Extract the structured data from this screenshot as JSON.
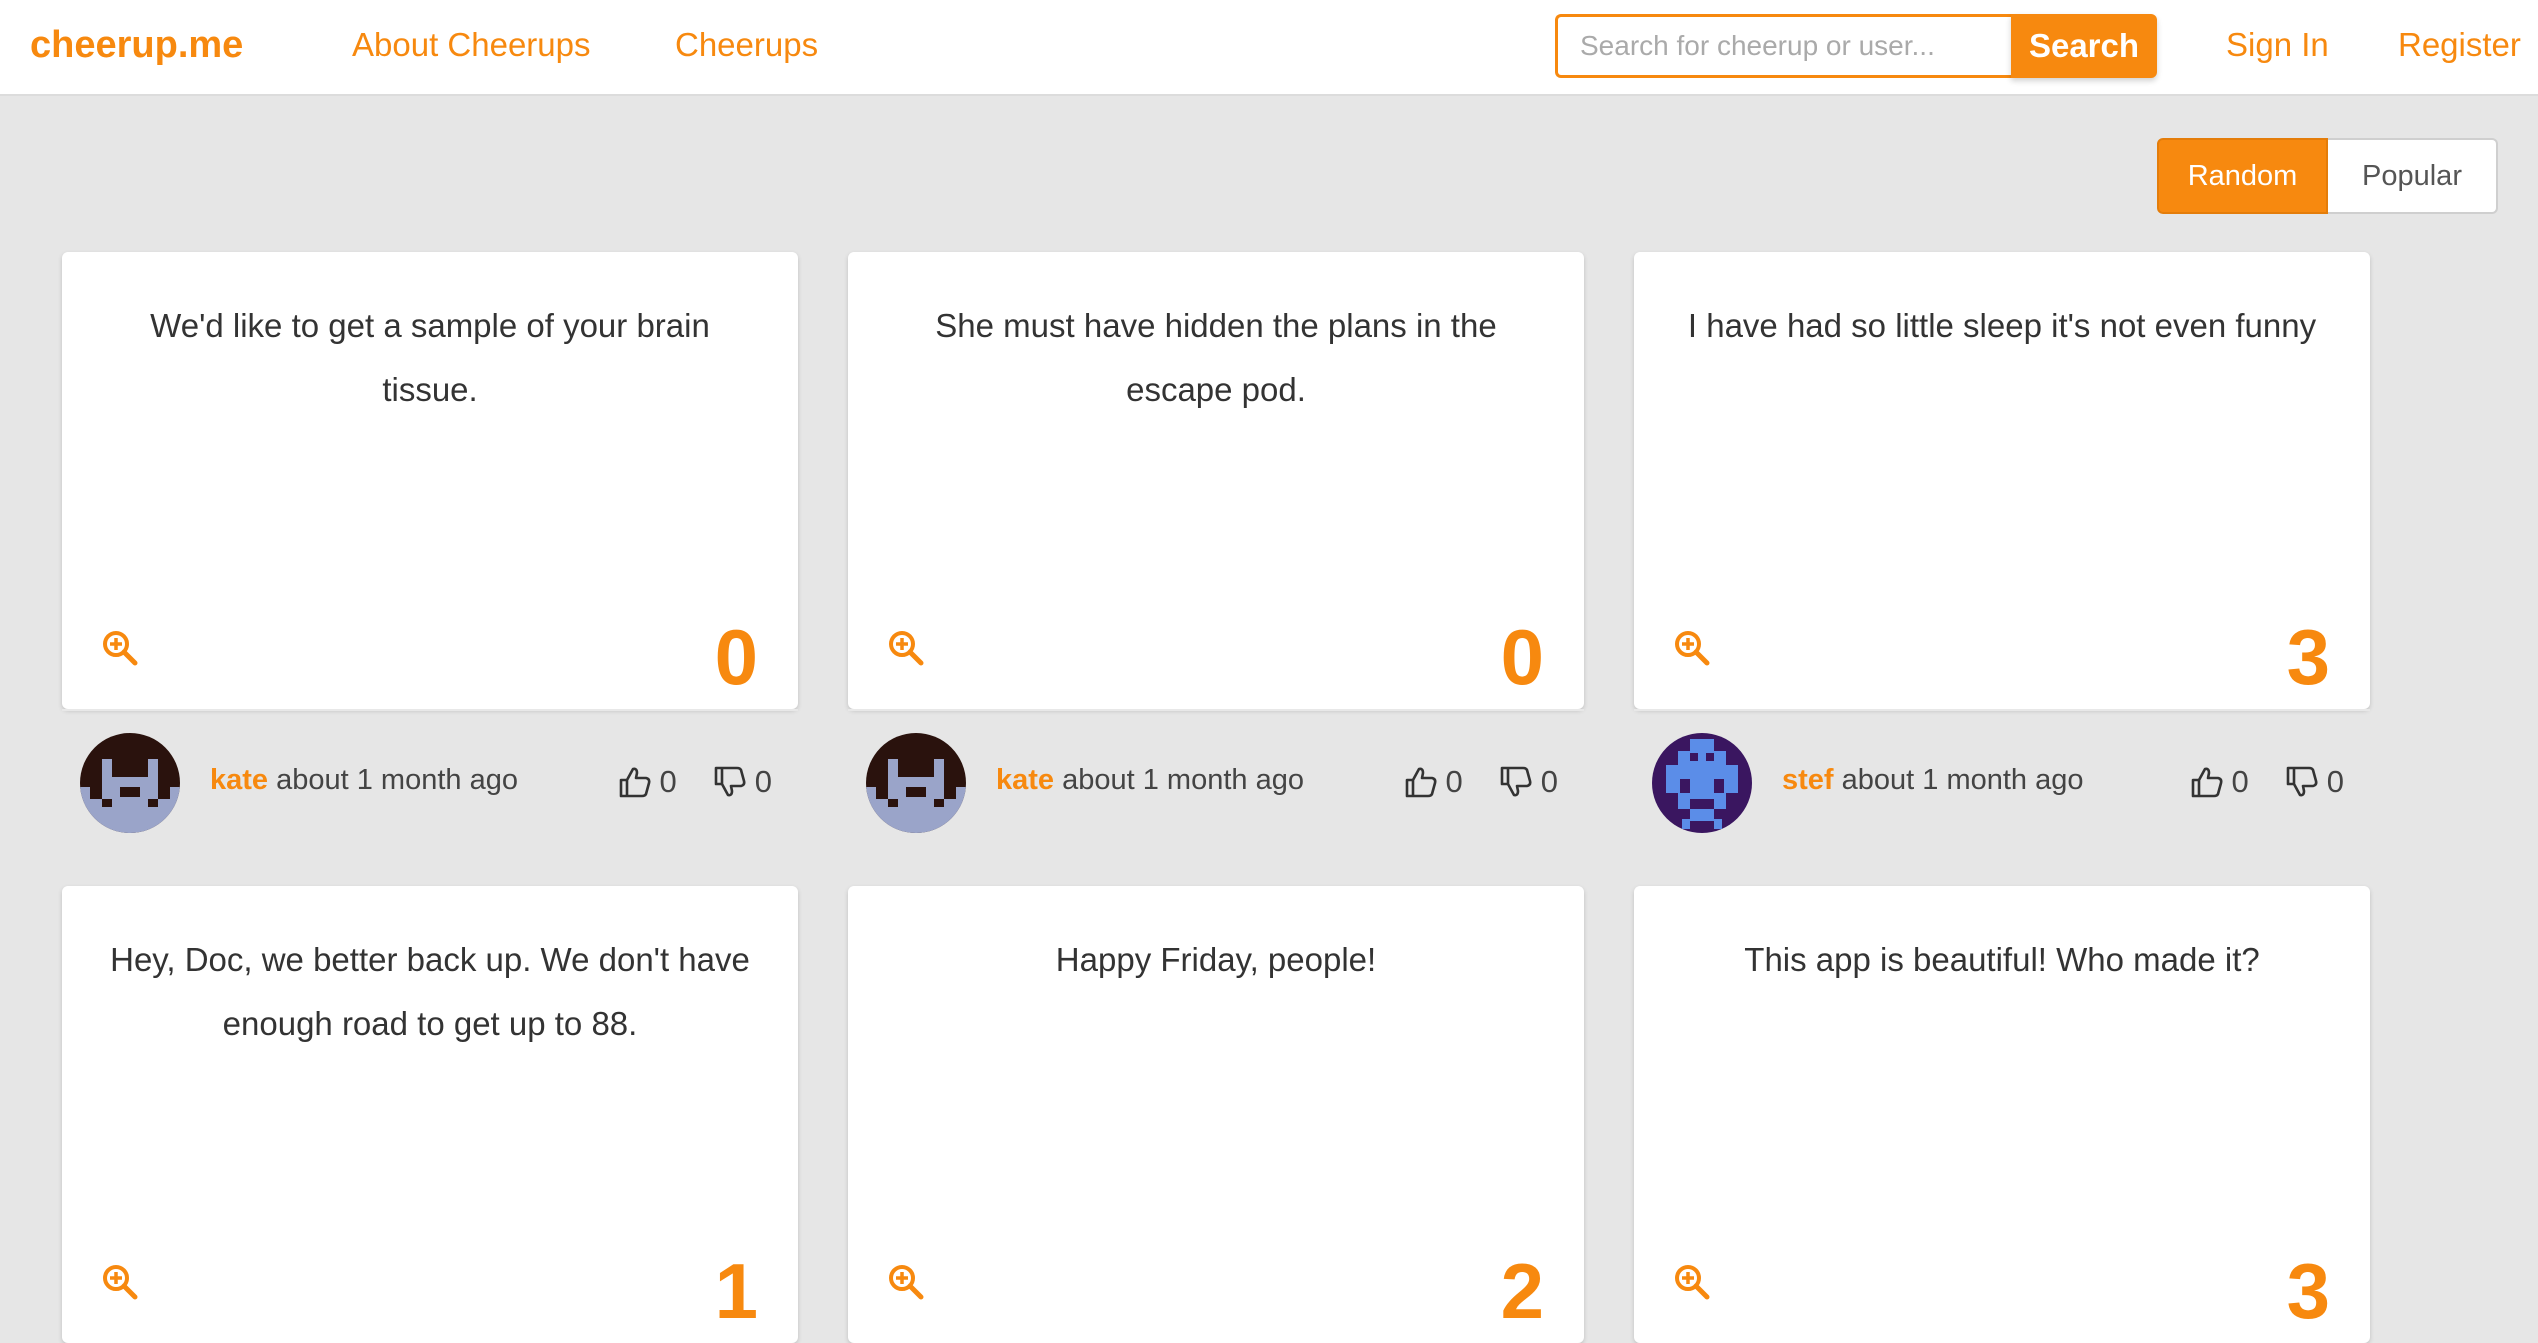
{
  "brand": "cheerup.me",
  "nav": {
    "about": "About Cheerups",
    "cheerups": "Cheerups",
    "sign_in": "Sign In",
    "register": "Register"
  },
  "search": {
    "placeholder": "Search for cheerup or user...",
    "value": "",
    "button": "Search"
  },
  "sort": {
    "random": "Random",
    "popular": "Popular",
    "selected": "Random"
  },
  "colors": {
    "accent": "#f7890f",
    "background": "#e6e6e6"
  },
  "cards": [
    {
      "text": "We'd like to get a sample of your brain tissue.",
      "score": "0",
      "user": "kate",
      "time": "about 1 month ago",
      "likes": "0",
      "dislikes": "0",
      "avatar": "kate"
    },
    {
      "text": "She must have hidden the plans in the escape pod.",
      "score": "0",
      "user": "kate",
      "time": "about 1 month ago",
      "likes": "0",
      "dislikes": "0",
      "avatar": "kate"
    },
    {
      "text": "I have had so little sleep it's not even funny",
      "score": "3",
      "user": "stef",
      "time": "about 1 month ago",
      "likes": "0",
      "dislikes": "0",
      "avatar": "stef"
    },
    {
      "text": "Hey, Doc, we better back up. We don't have enough road to get up to 88.",
      "score": "1"
    },
    {
      "text": "Happy Friday, people!",
      "score": "2"
    },
    {
      "text": "This app is beautiful! Who made it?",
      "score": "3"
    }
  ]
}
